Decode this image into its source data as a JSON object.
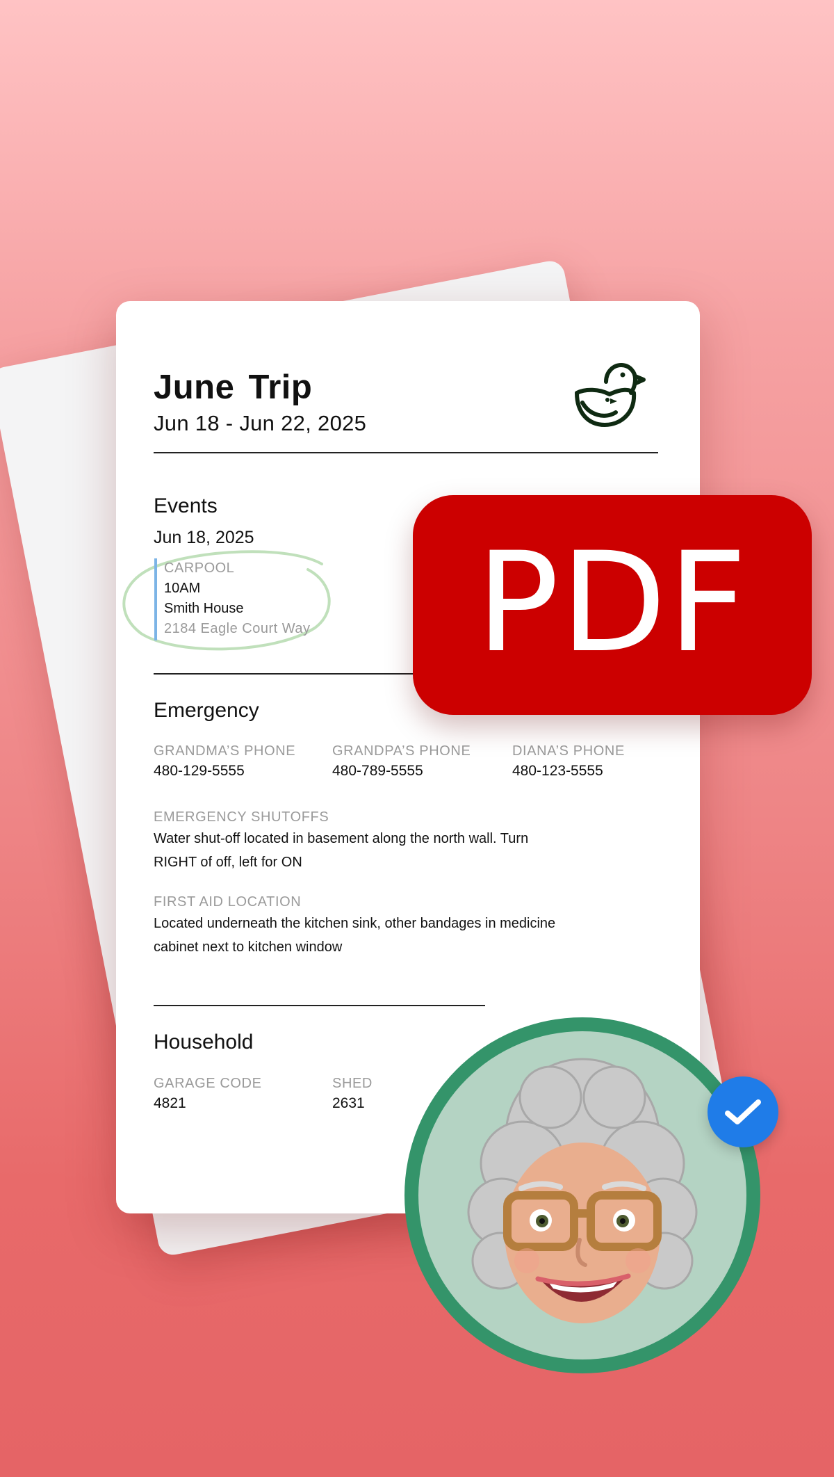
{
  "document": {
    "title": "June Trip",
    "date_range": "Jun 18 - Jun 22, 2025",
    "events": {
      "heading": "Events",
      "date": "Jun 18, 2025",
      "item": {
        "category": "CARPOOL",
        "time": "10AM",
        "place": "Smith House",
        "address": "2184 Eagle Court Way"
      }
    },
    "emergency": {
      "heading": "Emergency",
      "phones": [
        {
          "label": "GRANDMA’S PHONE",
          "value": "480-129-5555"
        },
        {
          "label": "GRANDPA’S PHONE",
          "value": "480-789-5555"
        },
        {
          "label": "DIANA’S PHONE",
          "value": "480-123-5555"
        }
      ],
      "shutoffs": {
        "label": "EMERGENCY SHUTOFFS",
        "line1": "Water shut-off located in basement along the north wall. Turn",
        "line2": "RIGHT of off, left for ON"
      },
      "first_aid": {
        "label": "FIRST AID LOCATION",
        "line1": "Located underneath the kitchen sink, other bandages in medicine",
        "line2": "cabinet next to kitchen window"
      }
    },
    "household": {
      "heading": "Household",
      "codes": [
        {
          "label": "GARAGE CODE",
          "value": "4821"
        },
        {
          "label": "SHED",
          "value": "2631"
        }
      ]
    }
  },
  "badge": {
    "text": "PDF",
    "color": "#CC0000"
  },
  "icons": {
    "logo": "bird-logo-icon",
    "avatar": "memoji-avatar",
    "check": "checkmark-icon"
  },
  "colors": {
    "accent_blue": "#1F7CE8",
    "avatar_ring": "#34946A",
    "event_bar": "#7CB4E6"
  }
}
